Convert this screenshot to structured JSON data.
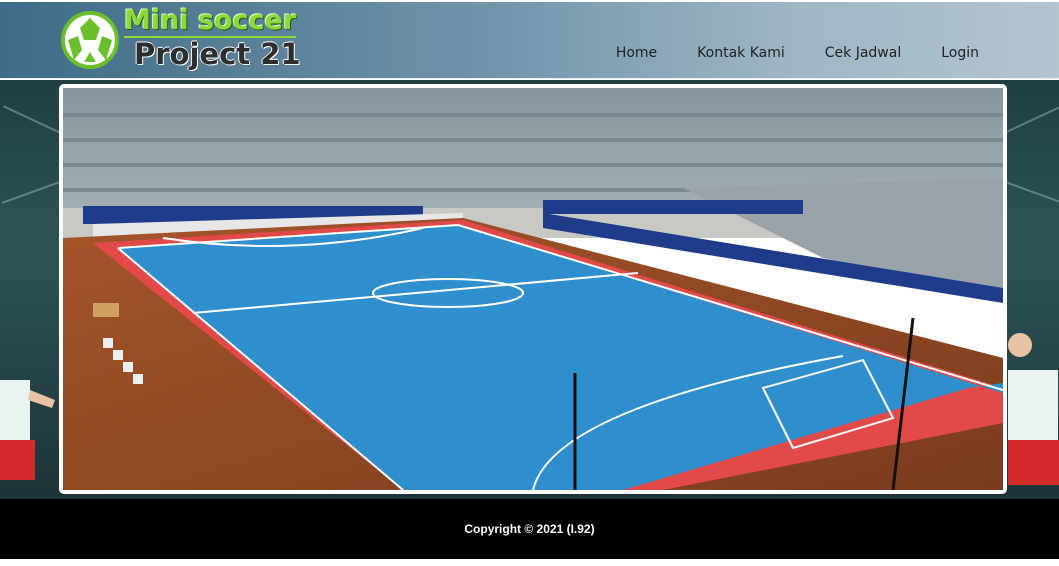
{
  "brand": {
    "line1": "Mini soccer",
    "line2": "Project 21"
  },
  "nav": {
    "items": [
      {
        "label": "Home"
      },
      {
        "label": "Kontak Kami"
      },
      {
        "label": "Cek Jadwal"
      },
      {
        "label": "Login"
      }
    ]
  },
  "hero": {
    "image": "futsal-stadium-photo"
  },
  "footer": {
    "copyright": "Copyright © 2021 (I.92)"
  },
  "colors": {
    "header_start": "#3f6b86",
    "header_end": "#b3c4cf",
    "brand_green": "#8cd93a",
    "court_blue": "#2f8fcc",
    "court_border": "#e24a4a",
    "footer_bg": "#000000"
  }
}
